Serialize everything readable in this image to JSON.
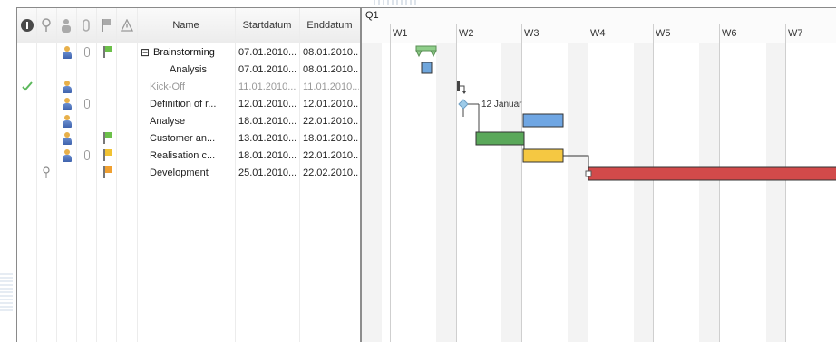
{
  "columns": {
    "icon_headers": [
      "info-header-icon",
      "pin-header-icon",
      "resource-header-icon",
      "attachment-header-icon",
      "priority-header-icon",
      "alert-header-icon"
    ],
    "name": "Name",
    "start": "Startdatum",
    "end": "Enddatum"
  },
  "tasks": [
    {
      "expander": "⊟",
      "name": "Brainstorming",
      "start": "07.01.2010...",
      "end": "08.01.2010...",
      "done": false,
      "resource": true,
      "attachment": true,
      "flag": "green",
      "pin": false
    },
    {
      "expander": "",
      "name": "Analysis",
      "start": "07.01.2010...",
      "end": "08.01.2010...",
      "done": false,
      "resource": false,
      "attachment": false,
      "flag": "",
      "pin": false
    },
    {
      "expander": "",
      "name": "Kick-Off",
      "start": "11.01.2010...",
      "end": "11.01.2010...",
      "done": true,
      "resource": true,
      "attachment": false,
      "flag": "",
      "pin": false
    },
    {
      "expander": "",
      "name": "Definition of r...",
      "start": "12.01.2010...",
      "end": "12.01.2010...",
      "done": false,
      "resource": true,
      "attachment": true,
      "flag": "",
      "pin": false
    },
    {
      "expander": "",
      "name": "Analyse",
      "start": "18.01.2010...",
      "end": "22.01.2010...",
      "done": false,
      "resource": true,
      "attachment": false,
      "flag": "",
      "pin": false
    },
    {
      "expander": "",
      "name": "Customer an...",
      "start": "13.01.2010...",
      "end": "18.01.2010...",
      "done": false,
      "resource": true,
      "attachment": false,
      "flag": "green",
      "pin": false
    },
    {
      "expander": "",
      "name": "Realisation c...",
      "start": "18.01.2010...",
      "end": "22.01.2010...",
      "done": false,
      "resource": true,
      "attachment": true,
      "flag": "yellow",
      "pin": false
    },
    {
      "expander": "",
      "name": "Development",
      "start": "25.01.2010...",
      "end": "22.02.2010...",
      "done": false,
      "resource": false,
      "attachment": false,
      "flag": "orange",
      "pin": true
    }
  ],
  "gantt": {
    "quarter": "Q1",
    "weeks": [
      "W1",
      "W2",
      "W3",
      "W4",
      "W5",
      "W6",
      "W7"
    ],
    "milestone_label": "12 Januar",
    "colors": {
      "summary": "#8fce8a",
      "analysis": "#6fa6dc",
      "blue": "#6fa6e3",
      "green": "#5aa85a",
      "yellow": "#f5c842",
      "red": "#d24a4a",
      "check": "#5cb85c",
      "milestone": "#9ecbe8"
    }
  }
}
